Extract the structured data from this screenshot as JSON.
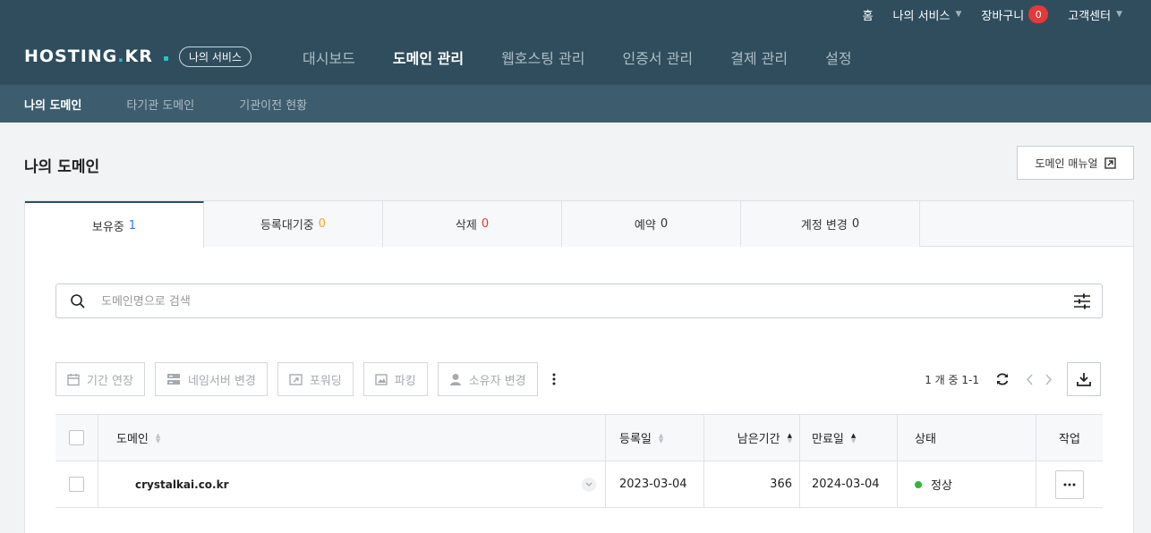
{
  "header": {
    "util": {
      "home": "홈",
      "my_services": "나의 서비스",
      "cart": "장바구니",
      "cart_count": "0",
      "support": "고객센터"
    },
    "logo_left": "HOSTING",
    "logo_right": "KR",
    "service_pill": "나의 서비스",
    "nav": [
      "대시보드",
      "도메인 관리",
      "웹호스팅 관리",
      "인증서 관리",
      "결제 관리",
      "설정"
    ],
    "active_nav_index": 1
  },
  "subnav": {
    "items": [
      "나의 도메인",
      "타기관 도메인",
      "기관이전 현황"
    ],
    "active_index": 0
  },
  "page": {
    "title": "나의 도메인",
    "manual_button": "도메인 매뉴얼"
  },
  "tabs": [
    {
      "label": "보유중",
      "count": "1",
      "color": "blue"
    },
    {
      "label": "등록대기중",
      "count": "0",
      "color": "orange"
    },
    {
      "label": "삭제",
      "count": "0",
      "color": "red"
    },
    {
      "label": "예약",
      "count": "0",
      "color": "gray"
    },
    {
      "label": "계정 변경",
      "count": "0",
      "color": "gray"
    }
  ],
  "search": {
    "placeholder": "도메인명으로 검색"
  },
  "toolbar": {
    "extend": "기간 연장",
    "nameserver": "네임서버 변경",
    "forwarding": "포워딩",
    "parking": "파킹",
    "owner": "소유자 변경"
  },
  "pager": {
    "text": "1 개 중 1-1"
  },
  "table": {
    "columns": {
      "domain": "도메인",
      "registered": "등록일",
      "remaining": "남은기간",
      "expires": "만료일",
      "status": "상태",
      "action": "작업"
    },
    "rows": [
      {
        "domain": "crystalkai.co.kr",
        "registered": "2023-03-04",
        "remaining": "366",
        "expires": "2024-03-04",
        "status": "정상"
      }
    ]
  },
  "colors": {
    "header_bg": "#2f4d5d",
    "subnav_bg": "#3d5d6e",
    "accent_teal": "#27c4c9",
    "badge_red": "#e5383b",
    "status_green": "#2db53f"
  }
}
